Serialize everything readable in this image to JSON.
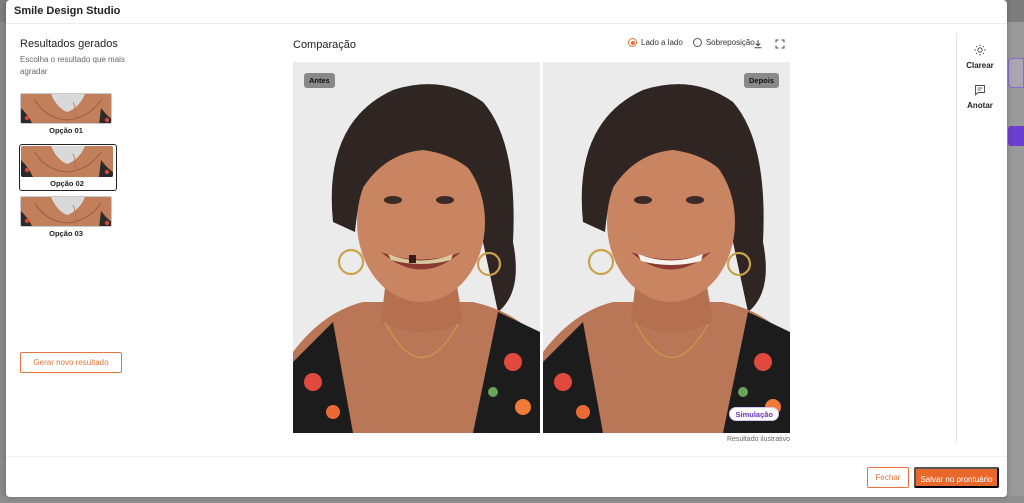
{
  "window": {
    "title": "Smile Design Studio"
  },
  "left_panel": {
    "title": "Resultados gerados",
    "subtitle": "Escolha o resultado que mais agradar",
    "options": [
      {
        "label": "Opção 01",
        "selected": false
      },
      {
        "label": "Opção 02",
        "selected": true
      },
      {
        "label": "Opção 03",
        "selected": false
      }
    ],
    "generate_button": "Gerar novo resultado"
  },
  "comparison": {
    "title": "Comparação",
    "view_modes": [
      {
        "label": "Lado a lado",
        "selected": true
      },
      {
        "label": "Sobreposição",
        "selected": false
      }
    ],
    "before_tag": "Antes",
    "after_tag": "Depois",
    "simulation_badge": "Simulação",
    "caption": "Resultado ilustrativo"
  },
  "tools": [
    {
      "label": "Clarear",
      "icon": "sun-icon"
    },
    {
      "label": "Anotar",
      "icon": "note-icon"
    }
  ],
  "footer": {
    "close_button": "Fechar",
    "save_button": "Salvar no prontuário"
  },
  "colors": {
    "accent": "#e8733a",
    "save_bg": "#e8682c",
    "simulation_text": "#6b2fc7"
  }
}
